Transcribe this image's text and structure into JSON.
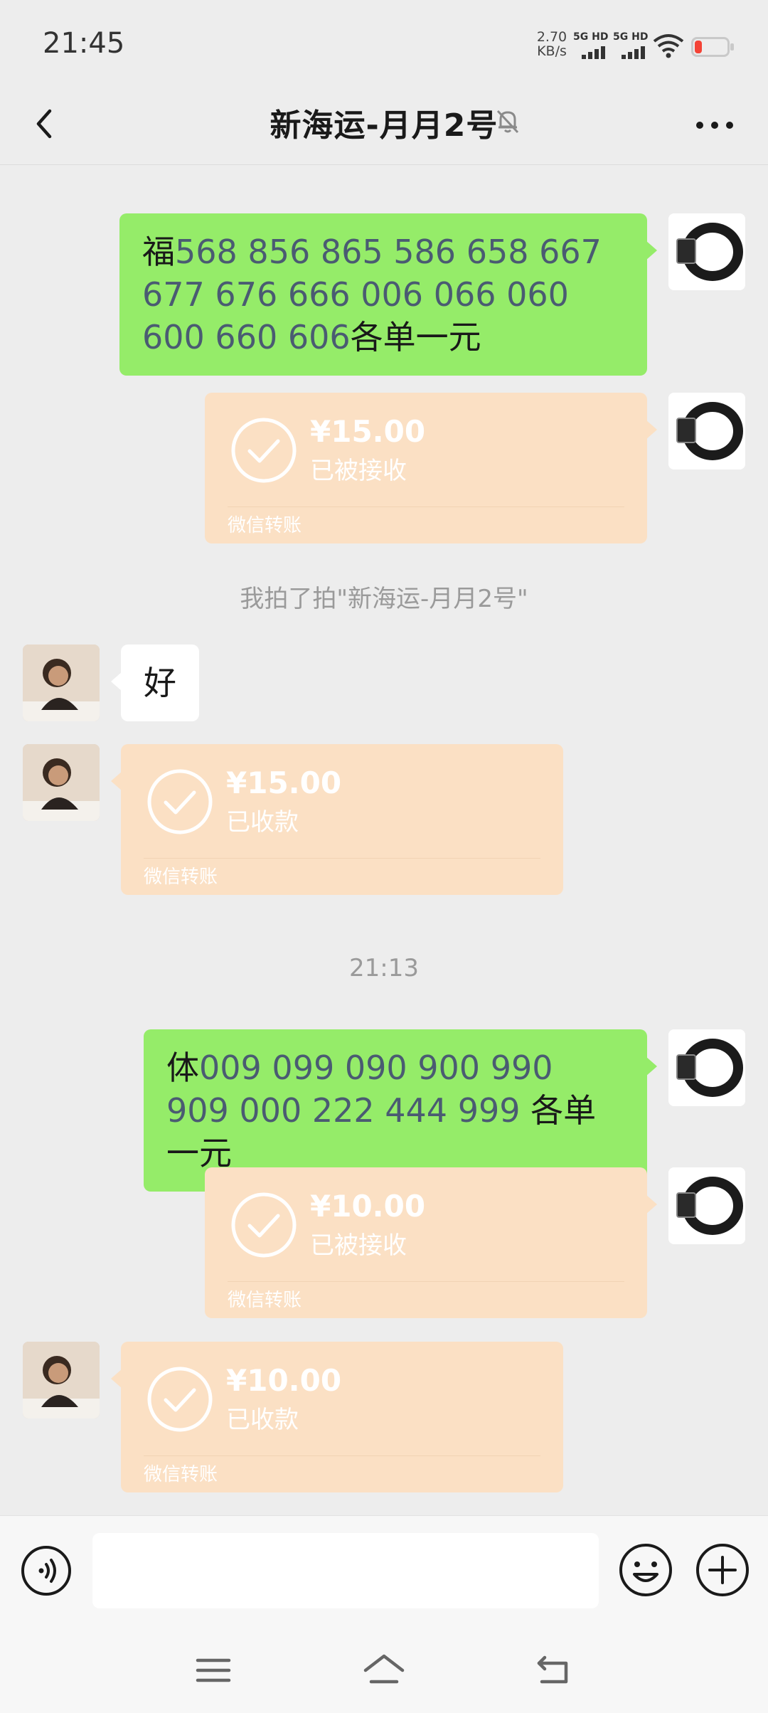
{
  "status_bar": {
    "time": "21:45",
    "net_speed_value": "2.70",
    "net_speed_unit": "KB/s",
    "sim1_label": "5G HD",
    "sim2_label": "5G HD",
    "battery_color": "#f44336"
  },
  "nav": {
    "title": "新海运-月月2号",
    "icons": {
      "back": "chevron-left-icon",
      "mute": "bell-off-icon",
      "more": "more-dots-icon"
    }
  },
  "messages": [
    {
      "type": "text",
      "side": "me",
      "prefix": "福",
      "numbers": "568 856 865 586 658  667 677 676 666 006 066 060 600 660 606",
      "suffix": "各单一元"
    },
    {
      "type": "transfer",
      "side": "me",
      "amount": "¥15.00",
      "status": "已被接收",
      "footer": "微信转账"
    },
    {
      "type": "system",
      "text": "我拍了拍\"新海运-月月2号\""
    },
    {
      "type": "text",
      "side": "other",
      "text": "好"
    },
    {
      "type": "transfer",
      "side": "other",
      "amount": "¥15.00",
      "status": "已收款",
      "footer": "微信转账"
    },
    {
      "type": "time",
      "text": "21:13"
    },
    {
      "type": "text",
      "side": "me",
      "prefix": "体",
      "numbers": "009 099 090 900 990 909 000 222 444 999",
      "suffix": "各单一元"
    },
    {
      "type": "transfer",
      "side": "me",
      "amount": "¥10.00",
      "status": "已被接收",
      "footer": "微信转账"
    },
    {
      "type": "transfer",
      "side": "other",
      "amount": "¥10.00",
      "status": "已收款",
      "footer": "微信转账"
    }
  ],
  "input_bar": {
    "placeholder": "",
    "icons": {
      "voice": "voice-icon",
      "emoji": "emoji-icon",
      "plus": "plus-circle-icon"
    }
  },
  "colors": {
    "background": "#ededed",
    "my_bubble": "#95ec69",
    "their_bubble": "#ffffff",
    "transfer_bubble": "#fbe0c4",
    "number_text": "#4a5b72"
  }
}
